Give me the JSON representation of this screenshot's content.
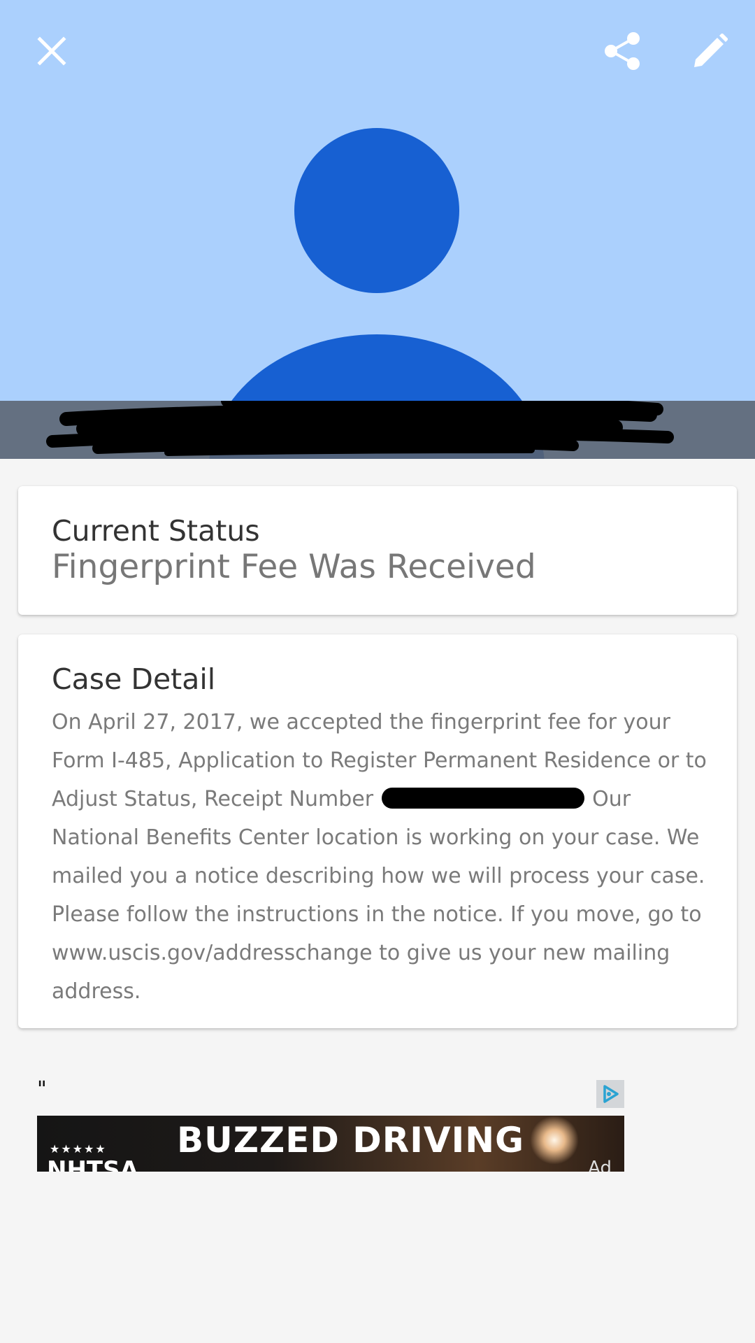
{
  "header": {
    "background_color": "#abd0fd",
    "avatar_color": "#1760d2",
    "close_icon": "close-icon",
    "share_icon": "share-icon",
    "edit_icon": "pencil-icon",
    "name": ""
  },
  "status_card": {
    "title": "Current Status",
    "value": "Fingerprint Fee Was Received"
  },
  "detail_card": {
    "title": "Case Detail",
    "body_part1": "On April 27, 2017, we accepted the fingerprint fee for your Form I-485, Application to Register Permanent Residence or to Adjust Status, Receipt Number",
    "body_part2": "Our National Benefits Center location is working on your case. We mailed you a notice describing how we will process your case. Please follow the instructions in the notice. If you move, go to www.uscis.gov/addresschange to give us your new mailing address."
  },
  "ad": {
    "quote": "\"",
    "choices_icon": "adchoices-icon",
    "stars": "★★★★★",
    "brand": "NHTSA",
    "headline": "BUZZED DRIVING",
    "badge": "Ad"
  }
}
